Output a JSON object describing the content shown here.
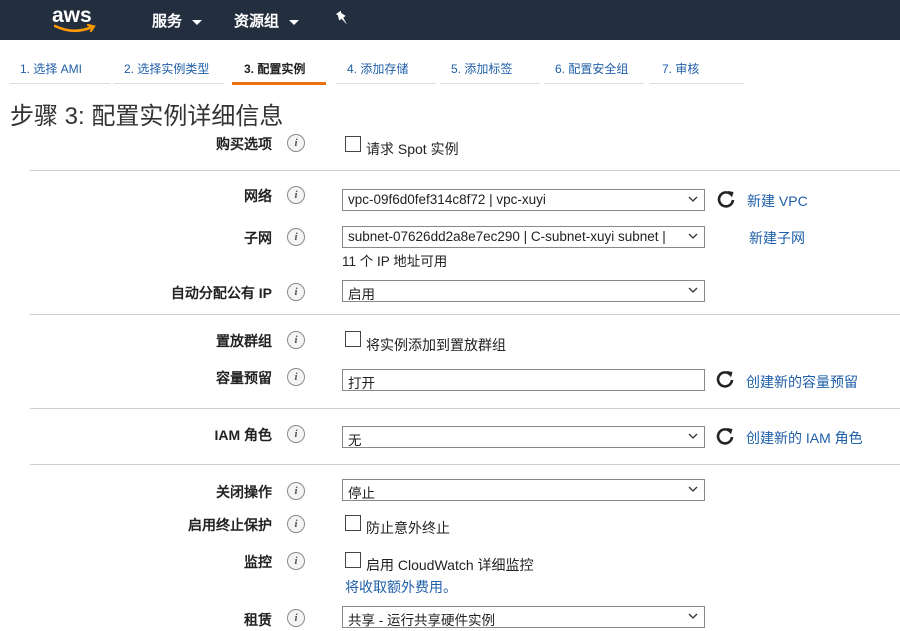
{
  "nav": {
    "logo": "aws",
    "services": "服务",
    "resource_groups": "资源组",
    "pin_icon": "pin-icon"
  },
  "steps": [
    {
      "label": "1. 选择 AMI"
    },
    {
      "label": "2. 选择实例类型"
    },
    {
      "label": "3. 配置实例"
    },
    {
      "label": "4. 添加存储"
    },
    {
      "label": "5. 添加标签"
    },
    {
      "label": "6. 配置安全组"
    },
    {
      "label": "7. 审核"
    }
  ],
  "active_step": 3,
  "page_title": "步骤 3: 配置实例详细信息",
  "form": {
    "purchase": {
      "label": "购买选项",
      "checkbox_label": "请求 Spot 实例",
      "checked": false
    },
    "network": {
      "label": "网络",
      "value": "vpc-09f6d0fef314c8f72 | vpc-xuyi",
      "link": "新建 VPC"
    },
    "subnet": {
      "label": "子网",
      "value": "subnet-07626dd2a8e7ec290 | C-subnet-xuyi subnet |",
      "hint": "11 个 IP 地址可用",
      "link": "新建子网"
    },
    "public_ip": {
      "label": "自动分配公有 IP",
      "value": "启用"
    },
    "placement": {
      "label": "置放群组",
      "checkbox_label": "将实例添加到置放群组",
      "checked": false
    },
    "capacity": {
      "label": "容量预留",
      "value": "打开",
      "link": "创建新的容量预留"
    },
    "iam": {
      "label": "IAM 角色",
      "value": "无",
      "link": "创建新的 IAM 角色"
    },
    "shutdown": {
      "label": "关闭操作",
      "value": "停止"
    },
    "termination": {
      "label": "启用终止保护",
      "checkbox_label": "防止意外终止",
      "checked": false
    },
    "monitoring": {
      "label": "监控",
      "checkbox_label": "启用 CloudWatch 详细监控",
      "note": "将收取额外费用。",
      "checked": false
    },
    "tenancy": {
      "label": "租赁",
      "value": "共享 - 运行共享硬件实例"
    }
  },
  "colors": {
    "nav_bg": "#232f3e",
    "link": "#1f5fa8",
    "active_tab_underline": "#ec7211"
  }
}
